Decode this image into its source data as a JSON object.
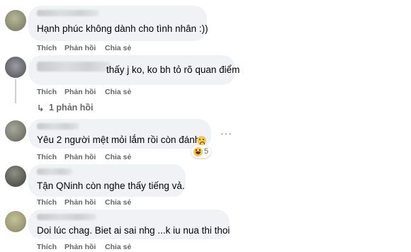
{
  "actions": {
    "like": "Thích",
    "reply": "Phản hồi",
    "share": "Chia sẻ"
  },
  "comments": [
    {
      "text": "Hạnh phúc không dành cho tình nhân :))"
    },
    {
      "text": "thấy j ko, ko bh tỏ rõ quan điểm",
      "reply_count": "1 phản hồi"
    },
    {
      "text": "Yêu 2 người mệt mỏi lắm rồi còn đánh",
      "reaction_count": "5",
      "reaction_icons": [
        "sad-icon",
        "haha-icon"
      ]
    },
    {
      "text": "Tận QNinh còn nghe thấy tiếng vả."
    },
    {
      "text": "Doi lúc chag. Biet ai sai nhg ...k iu nua thi thoi"
    }
  ],
  "colors": {
    "bubble": "#f0f2f5",
    "action_text": "#65676b",
    "text": "#050505"
  }
}
